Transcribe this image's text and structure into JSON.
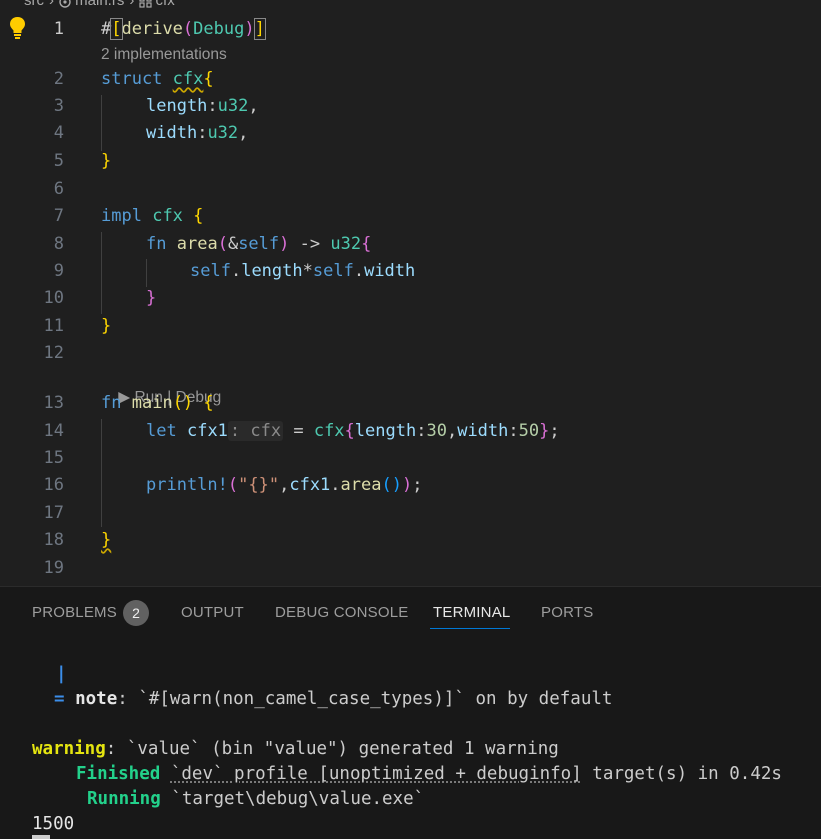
{
  "breadcrumb": {
    "folder": "src",
    "file": "main.rs",
    "symbol": "cfx"
  },
  "editor": {
    "code_lens_1": "2 implementations",
    "code_lens_2_run": "Run",
    "code_lens_2_sep": " | ",
    "code_lens_2_debug": "Debug",
    "run_glyph": "▶",
    "line_numbers": [
      "1",
      "2",
      "3",
      "4",
      "5",
      "6",
      "7",
      "8",
      "9",
      "10",
      "11",
      "12",
      "13",
      "14",
      "15",
      "16",
      "17",
      "18",
      "19"
    ],
    "line1": {
      "hash": "#",
      "open": "[",
      "derive": "derive",
      "p1": "(",
      "debug": "Debug",
      "p2": ")",
      "close": "]"
    },
    "line2": {
      "kw": "struct",
      "name": "cfx",
      "brace": "{"
    },
    "line3": {
      "field": "length",
      "colon": ":",
      "type": "u32",
      "comma": ","
    },
    "line4": {
      "field": "width",
      "colon": ":",
      "type": "u32",
      "comma": ","
    },
    "line5": {
      "brace": "}"
    },
    "line7": {
      "kw": "impl",
      "name": "cfx",
      "brace": "{"
    },
    "line8": {
      "kw": "fn",
      "name": "area",
      "p1": "(",
      "amp": "&",
      "self": "self",
      "p2": ")",
      "arrow": " -> ",
      "type": "u32",
      "brace": "{"
    },
    "line9": {
      "self1": "self",
      "dot1": ".",
      "f1": "length",
      "op": "*",
      "self2": "self",
      "dot2": ".",
      "f2": "width"
    },
    "line10": {
      "brace": "}"
    },
    "line11": {
      "brace": "}"
    },
    "line13": {
      "kw": "fn",
      "name": "main",
      "parens": "()",
      "brace": "{"
    },
    "line14": {
      "kw": "let",
      "var": "cfx1",
      "hint": ": cfx",
      "eq": " = ",
      "ty": "cfx",
      "b1": "{",
      "f1": "length",
      "c1": ":",
      "n1": "30",
      "comma": ",",
      "f2": "width",
      "c2": ":",
      "n2": "50",
      "b2": "}",
      "semi": ";"
    },
    "line16": {
      "mac": "println!",
      "p1": "(",
      "str": "\"{}\"",
      "comma": ",",
      "var": "cfx1",
      "dot": ".",
      "fn": "area",
      "p2": "()",
      "p3": ")",
      "semi": ";"
    },
    "line18": {
      "brace": "}"
    }
  },
  "panel": {
    "tabs": [
      "PROBLEMS",
      "OUTPUT",
      "DEBUG CONSOLE",
      "TERMINAL",
      "PORTS"
    ],
    "problems_count": "2",
    "active_tab": "TERMINAL"
  },
  "terminal": {
    "pipe": "|",
    "note_eq": "=",
    "note_label": "note",
    "note_text": ": `#[warn(non_camel_case_types)]` on by default",
    "warning_label": "warning",
    "warning_text": ": `value` (bin \"value\") generated 1 warning",
    "finished_label": "Finished",
    "finished_dotted": "`dev` profile [unoptimized + debuginfo]",
    "finished_rest": " target(s) in 0.42s",
    "running_label": "Running",
    "running_text": " `target\\debug\\value.exe`",
    "output": "1500"
  },
  "colors": {
    "accent": "#0078d4",
    "editor_bg": "#1f1f1f",
    "panel_bg": "#181818"
  }
}
